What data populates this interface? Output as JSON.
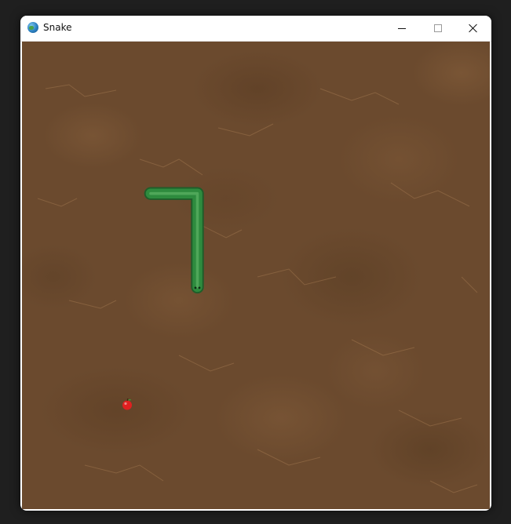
{
  "window": {
    "title": "Snake",
    "icon": "globe-icon"
  },
  "controls": {
    "minimize": "minimize-icon",
    "maximize": "maximize-icon",
    "close": "close-icon"
  },
  "colors": {
    "ground": "#6b4a2e",
    "snake_body": "#2e8b3e",
    "snake_outline": "#1f5e2a",
    "apple": "#e02020"
  },
  "game": {
    "grid_size": 20,
    "snake": [
      [
        5,
        6
      ],
      [
        6,
        6
      ],
      [
        7,
        6
      ],
      [
        7,
        7
      ],
      [
        7,
        8
      ],
      [
        7,
        9
      ],
      [
        7,
        10
      ]
    ],
    "snake_head": [
      7,
      10
    ],
    "apple": [
      4,
      15
    ],
    "direction": "down"
  }
}
